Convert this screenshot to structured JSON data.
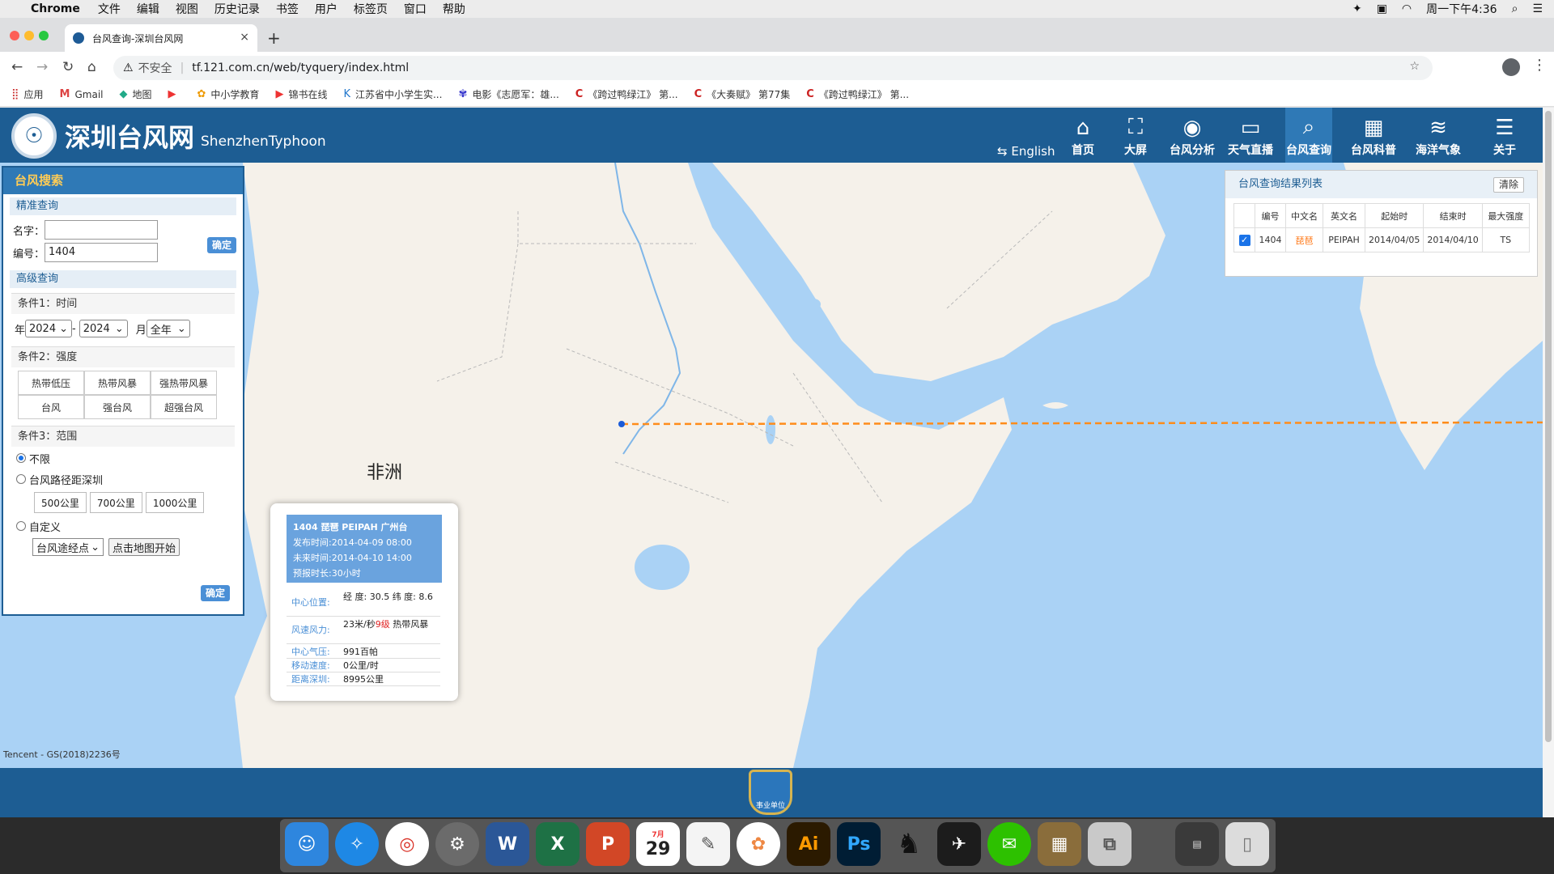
{
  "menubar": {
    "apple": "",
    "app": "Chrome",
    "items": [
      "文件",
      "编辑",
      "视图",
      "历史记录",
      "书签",
      "用户",
      "标签页",
      "窗口",
      "帮助"
    ],
    "clock": "周一下午4:36"
  },
  "tab": {
    "title": "台风查询-深圳台风网",
    "close": "×",
    "new": "+"
  },
  "omnibox": {
    "insecure": "不安全",
    "separator": "|",
    "url": "tf.121.com.cn/web/tyquery/index.html"
  },
  "bookmarks": [
    "应用",
    "Gmail",
    "地图",
    "",
    "中小学教育",
    "锦书在线",
    "江苏省中小学生实...",
    "电影《志愿军：雄...",
    "《跨过鸭绿江》 第...",
    "《大奏赋》 第77集",
    "《跨过鸭绿江》 第..."
  ],
  "site": {
    "name": "深圳台风网",
    "name_en": "ShenzhenTyphoon",
    "english": "English",
    "nav": [
      "首页",
      "大屏",
      "台风分析",
      "天气直播",
      "台风查询",
      "台风科普",
      "海洋气象",
      "关于"
    ]
  },
  "search": {
    "title": "台风搜索",
    "precise": "精准查询",
    "name_label": "名字：",
    "name_value": "",
    "id_label": "编号：",
    "id_value": "1404",
    "confirm": "确定",
    "advanced": "高级查询",
    "cond1": "条件1：时间",
    "year_label": "年",
    "year_from": "2024",
    "dash": "-",
    "year_to": "2024",
    "month_label": "月",
    "month_value": "全年",
    "cond2": "条件2：强度",
    "intensity": [
      "热带低压",
      "热带风暴",
      "强热带风暴",
      "台风",
      "强台风",
      "超强台风"
    ],
    "cond3": "条件3：范围",
    "range_any": "不限",
    "range_path": "台风路径距深圳",
    "distances": [
      "500公里",
      "700公里",
      "1000公里"
    ],
    "custom": "自定义",
    "custom_select": "台风途经点",
    "start_map": "点击地图开始",
    "confirm2": "确定"
  },
  "results": {
    "title": "台风查询结果列表",
    "clear": "清除",
    "headers": [
      "编号",
      "中文名",
      "英文名",
      "起始时",
      "结束时",
      "最大强度"
    ],
    "row": {
      "id": "1404",
      "cn": "琵琶",
      "en": "PEIPAH",
      "start": "2014/04/05",
      "end": "2014/04/10",
      "max": "TS"
    }
  },
  "map": {
    "africa": "非洲",
    "attribution": "Tencent - GS(2018)2236号"
  },
  "popup": {
    "line1": "1404 琵琶 PEIPAH 广州台",
    "line2": "发布时间:2014-04-09 08:00",
    "line3": "未来时间:2014-04-10 14:00",
    "line4": "预报时长:30小时",
    "pos_label": "中心位置:",
    "pos_value": "经 度: 30.5  纬 度: 8.6",
    "wind_label": "风速风力:",
    "wind_speed": "23米/秒",
    "wind_grade": "9级",
    "wind_type": "热带风暴",
    "pressure_label": "中心气压:",
    "pressure_value": "991百帕",
    "move_label": "移动速度:",
    "move_value": "0公里/时",
    "dist_label": "距离深圳:",
    "dist_value": "8995公里"
  },
  "footer": {
    "badge": "事业单位"
  },
  "dock": [
    "Finder",
    "Safari",
    "Chrome",
    "System Preferences",
    "Word",
    "Excel",
    "PowerPoint",
    "Calendar",
    "TextEdit",
    "Photos",
    "Illustrator",
    "Photoshop",
    "QQ",
    "Mail",
    "WeChat",
    "Calculator",
    "Archive",
    "Folder",
    "Trash"
  ],
  "calendar": {
    "month": "7月",
    "day": "29"
  },
  "colors": {
    "header_blue": "#1d5d93",
    "accent": "#2f79b6",
    "track": "#ff8c1a",
    "sea": "#aad2f5",
    "land": "#f5f1ea"
  }
}
